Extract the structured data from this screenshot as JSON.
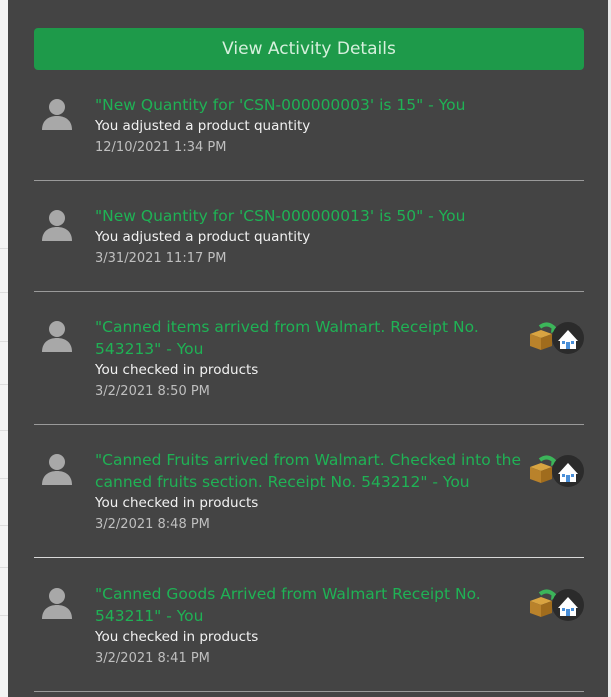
{
  "panel": {
    "view_button_label": "View Activity Details"
  },
  "activities": [
    {
      "title": "\"New Quantity for 'CSN-000000003' is 15\" - You",
      "subtitle": "You adjusted a product quantity",
      "timestamp": "12/10/2021 1:34 PM",
      "icon": "user-avatar-icon"
    },
    {
      "title": "\"New Quantity for 'CSN-000000013' is 50\" - You",
      "subtitle": "You adjusted a product quantity",
      "timestamp": "3/31/2021 11:17 PM",
      "icon": "user-avatar-icon"
    },
    {
      "title_lines": [
        "\"Canned items arrived from Walmart. Receipt No.",
        "543213\" - You"
      ],
      "subtitle": "You checked in products",
      "timestamp": "3/2/2021 8:50 PM",
      "icon": "user-avatar-icon",
      "action_icon": "box-to-warehouse-checkin-icon"
    },
    {
      "title_lines": [
        "\"Canned Fruits arrived from Walmart. Checked into the",
        "canned fruits section. Receipt No. 543212\" - You"
      ],
      "subtitle": "You checked in products",
      "timestamp": "3/2/2021 8:48 PM",
      "icon": "user-avatar-icon",
      "action_icon": "box-to-warehouse-checkin-icon"
    },
    {
      "title_lines": [
        "\"Canned Goods Arrived from Walmart Receipt No.",
        "543211\" - You"
      ],
      "subtitle": "You checked in products",
      "timestamp": "3/2/2021 8:41 PM",
      "icon": "user-avatar-icon",
      "action_icon": "box-to-warehouse-checkin-icon"
    }
  ],
  "colors": {
    "panel_bg": "#444444",
    "button_bg": "#1e9a4a",
    "title_green": "#1fb255"
  }
}
